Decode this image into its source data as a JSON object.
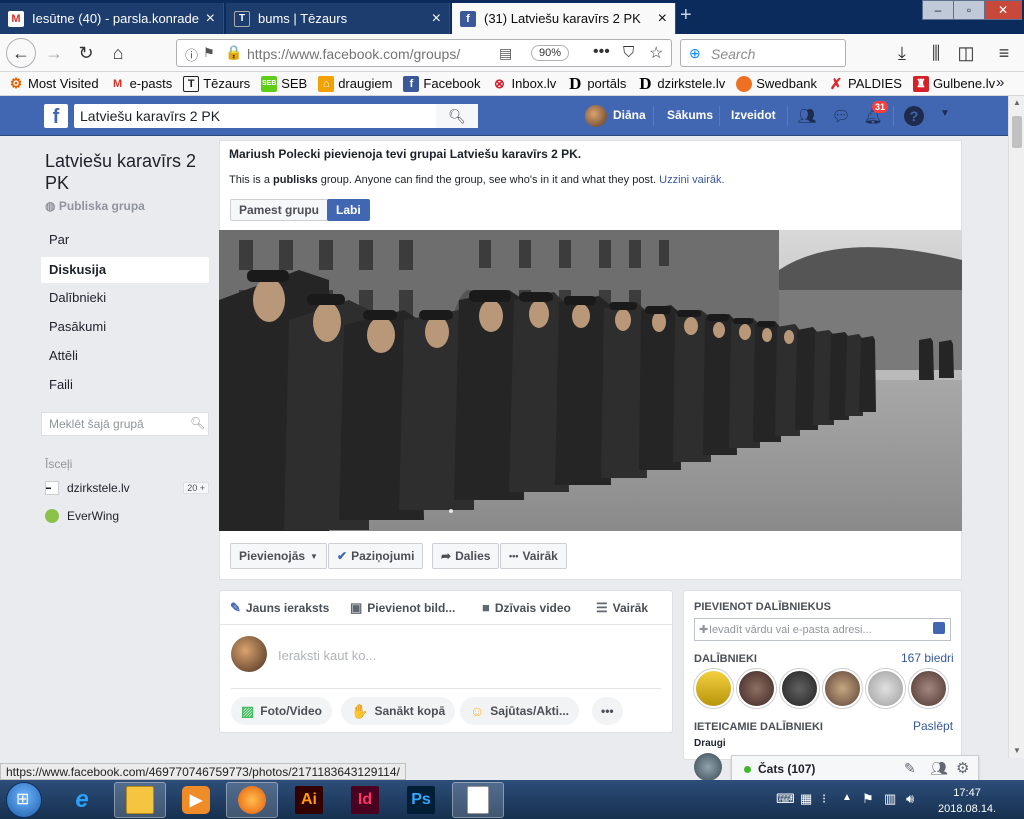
{
  "browser": {
    "tabs": [
      {
        "title": "Iesūtne (40) - parsla.konrade@",
        "active": false
      },
      {
        "title": "bums | Tēzaurs",
        "active": false
      },
      {
        "title": "(31) Latviešu karavīrs 2 PK",
        "active": true
      }
    ],
    "url": "https://www.facebook.com/groups/",
    "zoom": "90%",
    "search_placeholder": "Search",
    "bookmarks": [
      "Most Visited",
      "e-pasts",
      "Tēzaurs",
      "SEB",
      "draugiem",
      "Facebook",
      "Inbox.lv",
      "portāls",
      "dzirkstele.lv",
      "Swedbank",
      "PALDIES",
      "Gulbene.lv"
    ],
    "status_url": "https://www.facebook.com/469770746759773/photos/2171183643129114/"
  },
  "fb_header": {
    "search_value": "Latviešu karavīrs 2 PK",
    "user_name": "Diāna",
    "home": "Sākums",
    "create": "Izveidot",
    "notifications_count": "31"
  },
  "group": {
    "title": "Latviešu karavīrs 2 PK",
    "type": "Publiska grupa",
    "nav": [
      "Par",
      "Diskusija",
      "Dalībnieki",
      "Pasākumi",
      "Attēli",
      "Faili"
    ],
    "selected_nav": "Diskusija",
    "search_placeholder": "Meklēt šajā grupā",
    "shortcuts_title": "Īsceļi",
    "shortcuts": [
      {
        "name": "dzirkstele.lv",
        "badge": "20 +"
      },
      {
        "name": "EverWing",
        "badge": ""
      }
    ]
  },
  "notice": {
    "headline": "Mariush Polecki pievienoja tevi grupai Latviešu karavīrs 2 PK.",
    "text_pre": "This is a ",
    "text_bold": "publisks",
    "text_post": " group. Anyone can find the group, see who's in it and what they post.",
    "link": "Uzzini vairāk.",
    "leave_button": "Pamest grupu",
    "ok_button": "Labi"
  },
  "actions": {
    "joined": "Pievienojās",
    "notifications": "Paziņojumi",
    "share": "Dalies",
    "more": "Vairāk"
  },
  "composer": {
    "tabs": [
      "Jauns ieraksts",
      "Pievienot bild...",
      "Dzīvais video",
      "Vairāk"
    ],
    "placeholder": "Ieraksti kaut ko...",
    "pills": [
      "Foto/Video",
      "Sanākt kopā",
      "Sajūtas/Akti...",
      "•••"
    ]
  },
  "right": {
    "add_members_title": "Pievienot dalībniekus",
    "add_members_placeholder": "Ievadīt vārdu vai e-pasta adresi...",
    "members_title": "Dalībnieki",
    "members_count": "167 biedri",
    "suggested_title": "Ieteicamie dalībnieki",
    "hide": "Paslēpt",
    "friends_label": "Draugi"
  },
  "chat": {
    "label": "Čats (107)"
  },
  "taskbar": {
    "time": "17:47",
    "date": "2018.08.14."
  }
}
